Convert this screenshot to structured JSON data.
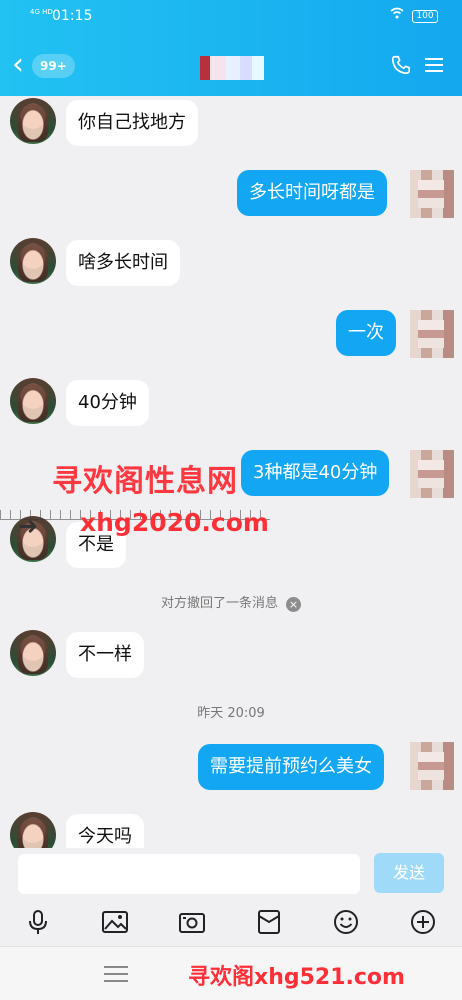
{
  "status_bar": {
    "signal": "4G HD",
    "time": "01:15",
    "battery": "100"
  },
  "header": {
    "unread_badge": "99+"
  },
  "messages": [
    {
      "side": "in",
      "text": "你自己找地方"
    },
    {
      "side": "out",
      "text": "多长时间呀都是"
    },
    {
      "side": "in",
      "text": "啥多长时间"
    },
    {
      "side": "out",
      "text": "一次"
    },
    {
      "side": "in",
      "text": "40分钟"
    },
    {
      "side": "out",
      "text": "3种都是40分钟"
    },
    {
      "side": "in",
      "text": "不是"
    },
    {
      "side": "in",
      "text": "不一样"
    },
    {
      "side": "out",
      "text": "需要提前预约么美女"
    },
    {
      "side": "in",
      "text": "今天吗"
    }
  ],
  "system_notes": {
    "recall": "对方撤回了一条消息",
    "timestamp": "昨天 20:09"
  },
  "watermarks": {
    "line1": "寻欢阁性息网",
    "line2": "xhg2020.com",
    "footer": "寻欢阁xhg521.com"
  },
  "input": {
    "value": "",
    "placeholder": "",
    "send_label": "发送"
  },
  "toolbar_icons": [
    "microphone-icon",
    "image-icon",
    "camera-icon",
    "red-envelope-icon",
    "emoji-icon",
    "plus-icon"
  ],
  "colors": {
    "header_start": "#22c2f2",
    "header_end": "#14a8ef",
    "outgoing_bubble": "#13a6f3",
    "send_disabled": "#9fdaf8",
    "watermark": "#ff2f38"
  }
}
